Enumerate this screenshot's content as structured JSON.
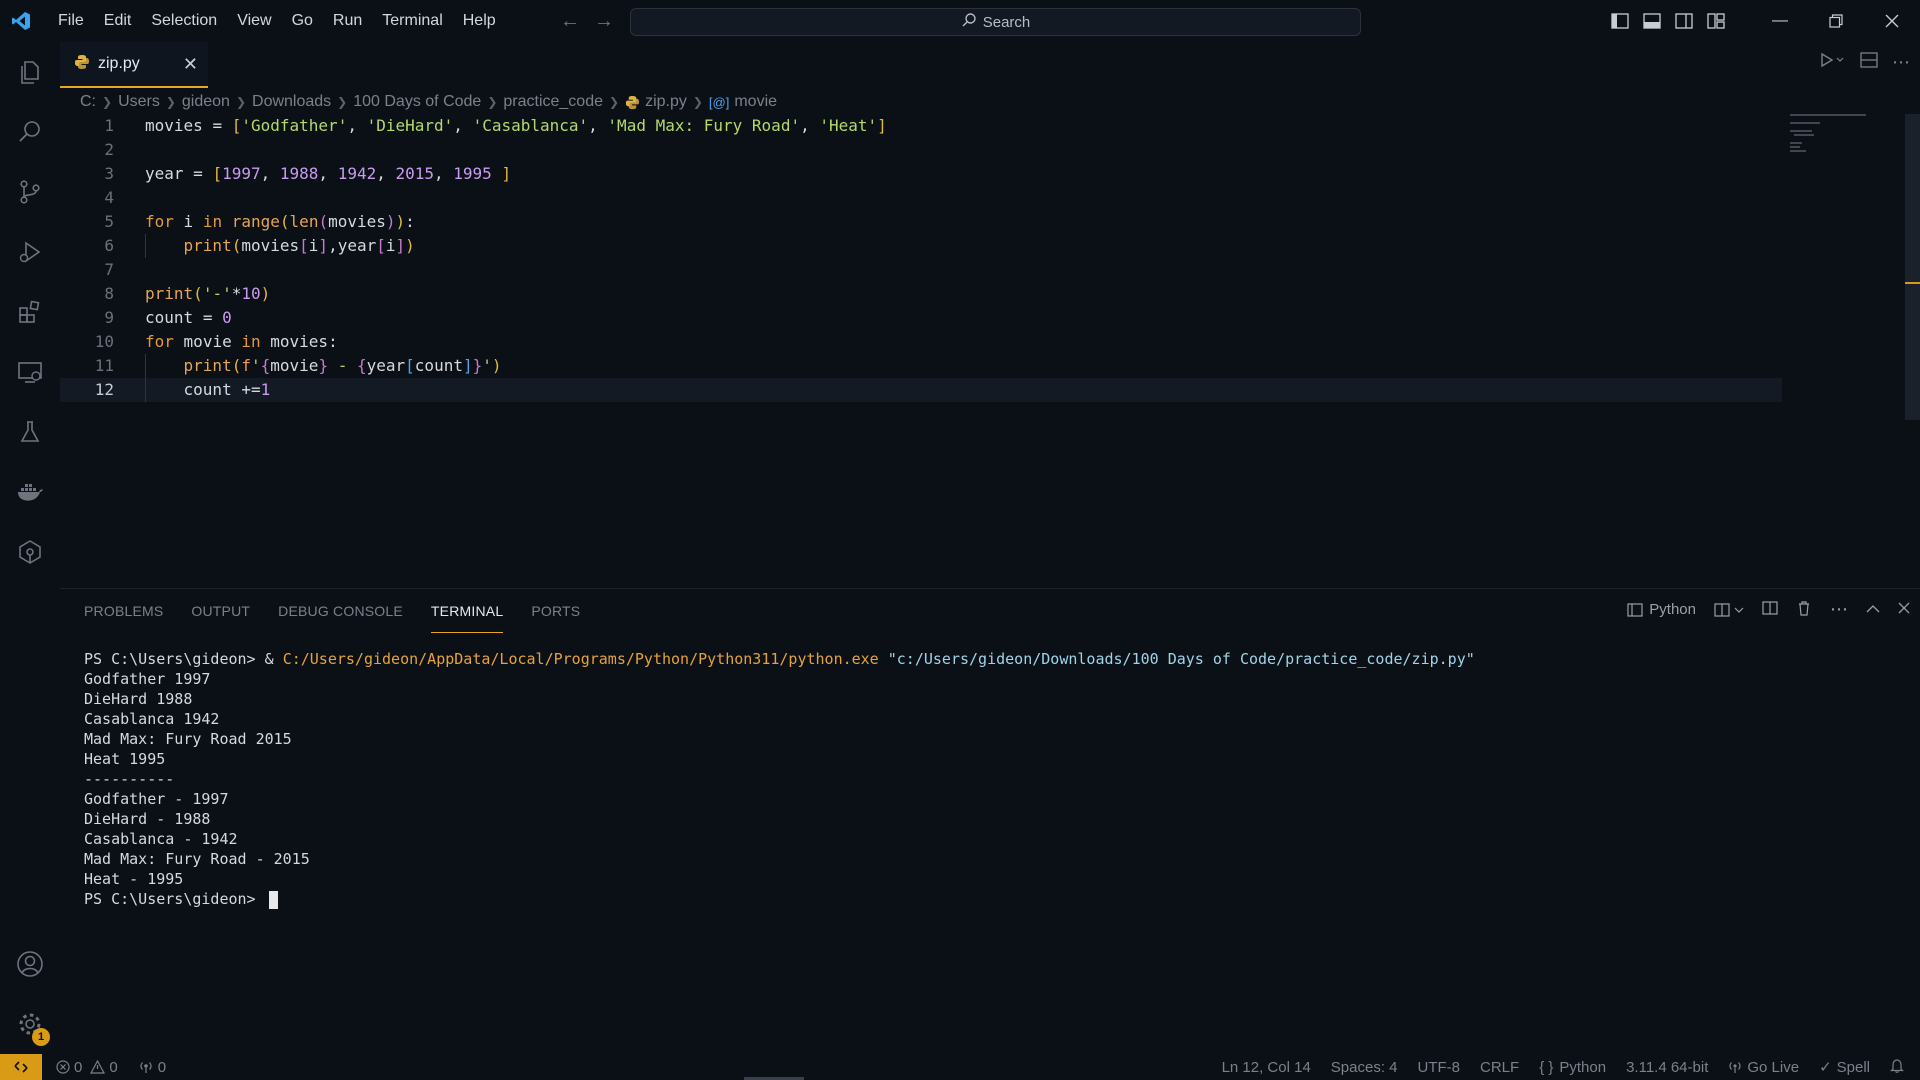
{
  "menu": [
    "File",
    "Edit",
    "Selection",
    "View",
    "Go",
    "Run",
    "Terminal",
    "Help"
  ],
  "search": {
    "label": "Search"
  },
  "tab": {
    "label": "zip.py"
  },
  "breadcrumb": [
    "C:",
    "Users",
    "gideon",
    "Downloads",
    "100 Days of Code",
    "practice_code",
    "zip.py",
    "movie"
  ],
  "code": {
    "line_numbers": [
      "1",
      "2",
      "3",
      "4",
      "5",
      "6",
      "7",
      "8",
      "9",
      "10",
      "11",
      "12"
    ],
    "active_line": 12
  },
  "panel": {
    "tabs": [
      "PROBLEMS",
      "OUTPUT",
      "DEBUG CONSOLE",
      "TERMINAL",
      "PORTS"
    ],
    "active_tab": "TERMINAL",
    "shell_label": "Python"
  },
  "terminal": {
    "prompt": "PS C:\\Users\\gideon> ",
    "command_amp": "& ",
    "exe": "C:/Users/gideon/AppData/Local/Programs/Python/Python311/python.exe",
    "script": "\"c:/Users/gideon/Downloads/100 Days of Code/practice_code/zip.py\"",
    "output": [
      "Godfather 1997",
      "DieHard 1988",
      "Casablanca 1942",
      "Mad Max: Fury Road 2015",
      "Heat 1995",
      "----------",
      "Godfather - 1997",
      "DieHard - 1988",
      "Casablanca - 1942",
      "Mad Max: Fury Road - 2015",
      "Heat - 1995"
    ],
    "final_prompt": "PS C:\\Users\\gideon> "
  },
  "status": {
    "errors": "0",
    "warnings": "0",
    "ports": "0",
    "position": "Ln 12, Col 14",
    "spaces": "Spaces: 4",
    "encoding": "UTF-8",
    "eol": "CRLF",
    "language": "Python",
    "interpreter": "3.11.4 64-bit",
    "go_live": "Go Live",
    "spell": "Spell"
  },
  "settings_badge": "1",
  "colors": {
    "accent": "#d99a16",
    "background": "#0b1017"
  },
  "icons": [
    "vscode-logo-icon",
    "explorer-icon",
    "search-icon",
    "source-control-icon",
    "run-debug-icon",
    "extensions-icon",
    "remote-explorer-icon",
    "testing-icon",
    "docker-icon",
    "gitlens-icon",
    "account-icon",
    "manage-gear-icon",
    "python-file-icon",
    "close-icon",
    "run-icon",
    "split-editor-icon",
    "more-icon",
    "bell-icon"
  ]
}
